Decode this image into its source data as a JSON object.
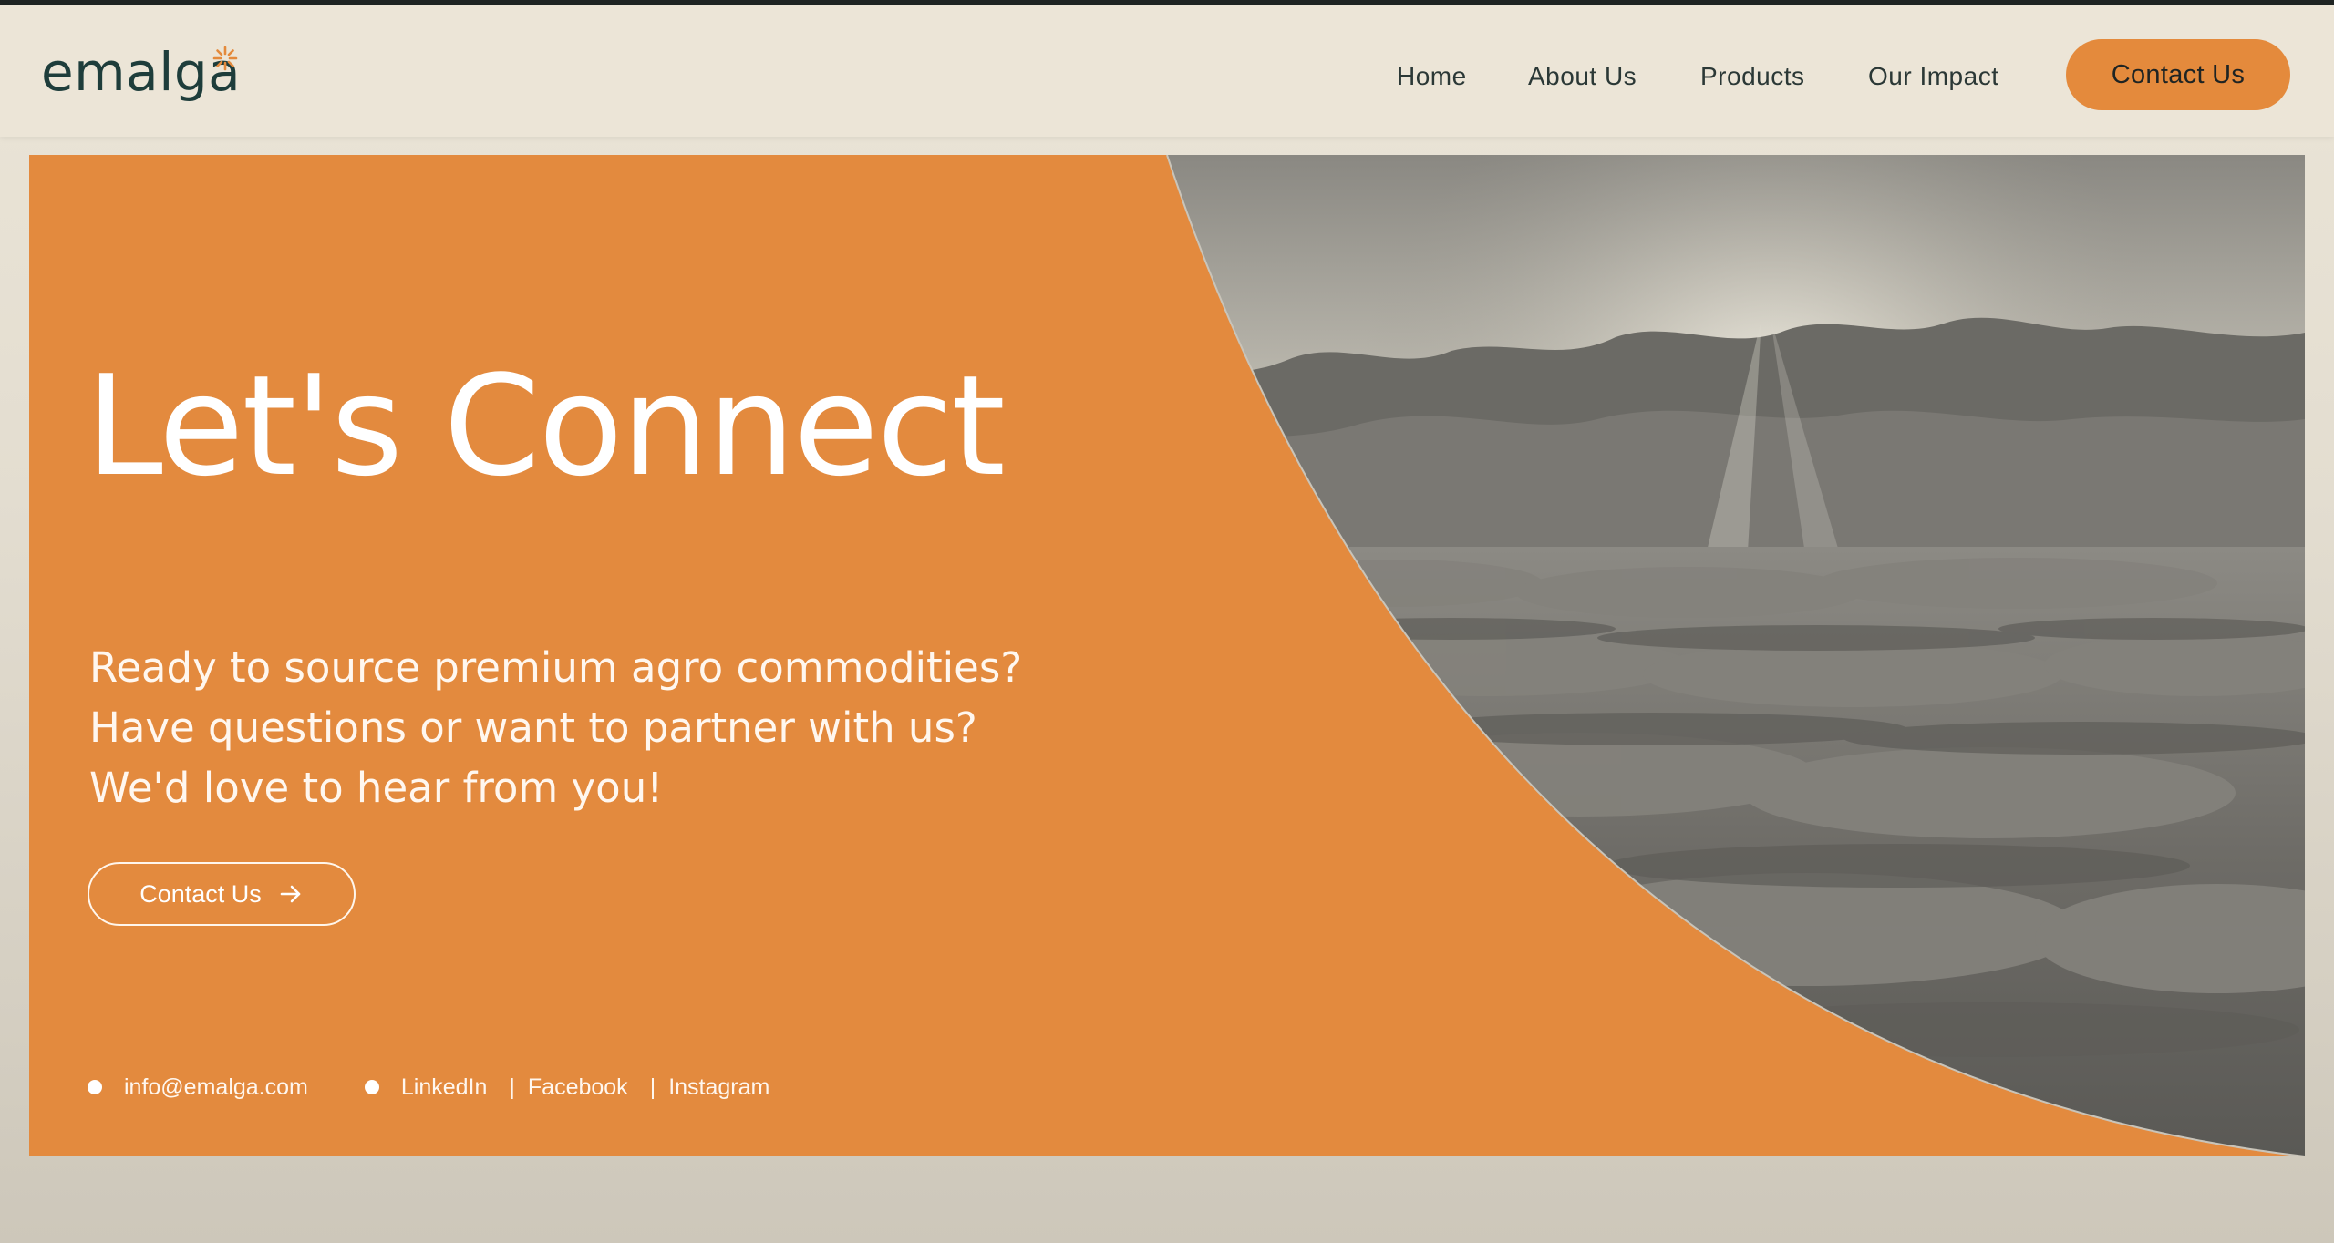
{
  "header": {
    "logo_text": "emalga",
    "nav": {
      "home": "Home",
      "about": "About Us",
      "products": "Products",
      "impact": "Our Impact"
    },
    "cta_label": "Contact Us"
  },
  "hero": {
    "title": "Let's Connect",
    "lines": [
      "Ready to source premium agro commodities?",
      "Have questions or want to partner with us?",
      "We'd love to hear from you!"
    ],
    "cta_label": "Contact Us",
    "email": "info@emalga.com",
    "social": {
      "linkedin": "LinkedIn",
      "facebook": "Facebook",
      "instagram": "Instagram",
      "separator": "|"
    }
  },
  "colors": {
    "accent": "#e38a3e",
    "text_dark": "#1e3d3b",
    "header_bg": "#ece5d7"
  },
  "icons": {
    "logo_mark": "sparkle-icon",
    "cta_arrow": "arrow-right-icon",
    "bullet": "dot-icon"
  }
}
